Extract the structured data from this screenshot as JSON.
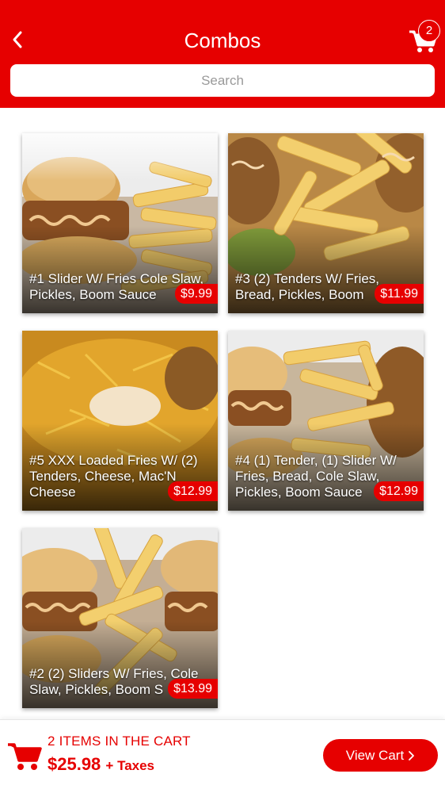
{
  "header": {
    "title": "Combos",
    "cart_count": "2",
    "colors": {
      "brand": "#e60000"
    }
  },
  "search": {
    "placeholder": "Search",
    "value": ""
  },
  "products": [
    {
      "name": "#1 Slider W/ Fries Cole Slaw, Pickles, Boom Sauce",
      "price": "$9.99"
    },
    {
      "name": "#3 (2) Tenders W/ Fries, Bread, Pickles, Boom",
      "price": "$11.99"
    },
    {
      "name": "#5 XXX Loaded Fries W/ (2) Tenders, Cheese, Mac'N Cheese",
      "price": "$12.99"
    },
    {
      "name": "#4 (1) Tender, (1) Slider W/ Fries, Bread, Cole Slaw, Pickles, Boom Sauce",
      "price": "$12.99"
    },
    {
      "name": "#2 (2) Sliders W/ Fries, Cole Slaw, Pickles, Boom S",
      "price": "$13.99"
    }
  ],
  "cart_bar": {
    "items_text": "2 ITEMS IN THE CART",
    "total": "$25.98",
    "taxes": "+ Taxes",
    "view_cart_label": "View Cart",
    "icons": {
      "cart": "cart-icon",
      "chevron": "chevron-right-icon"
    }
  }
}
